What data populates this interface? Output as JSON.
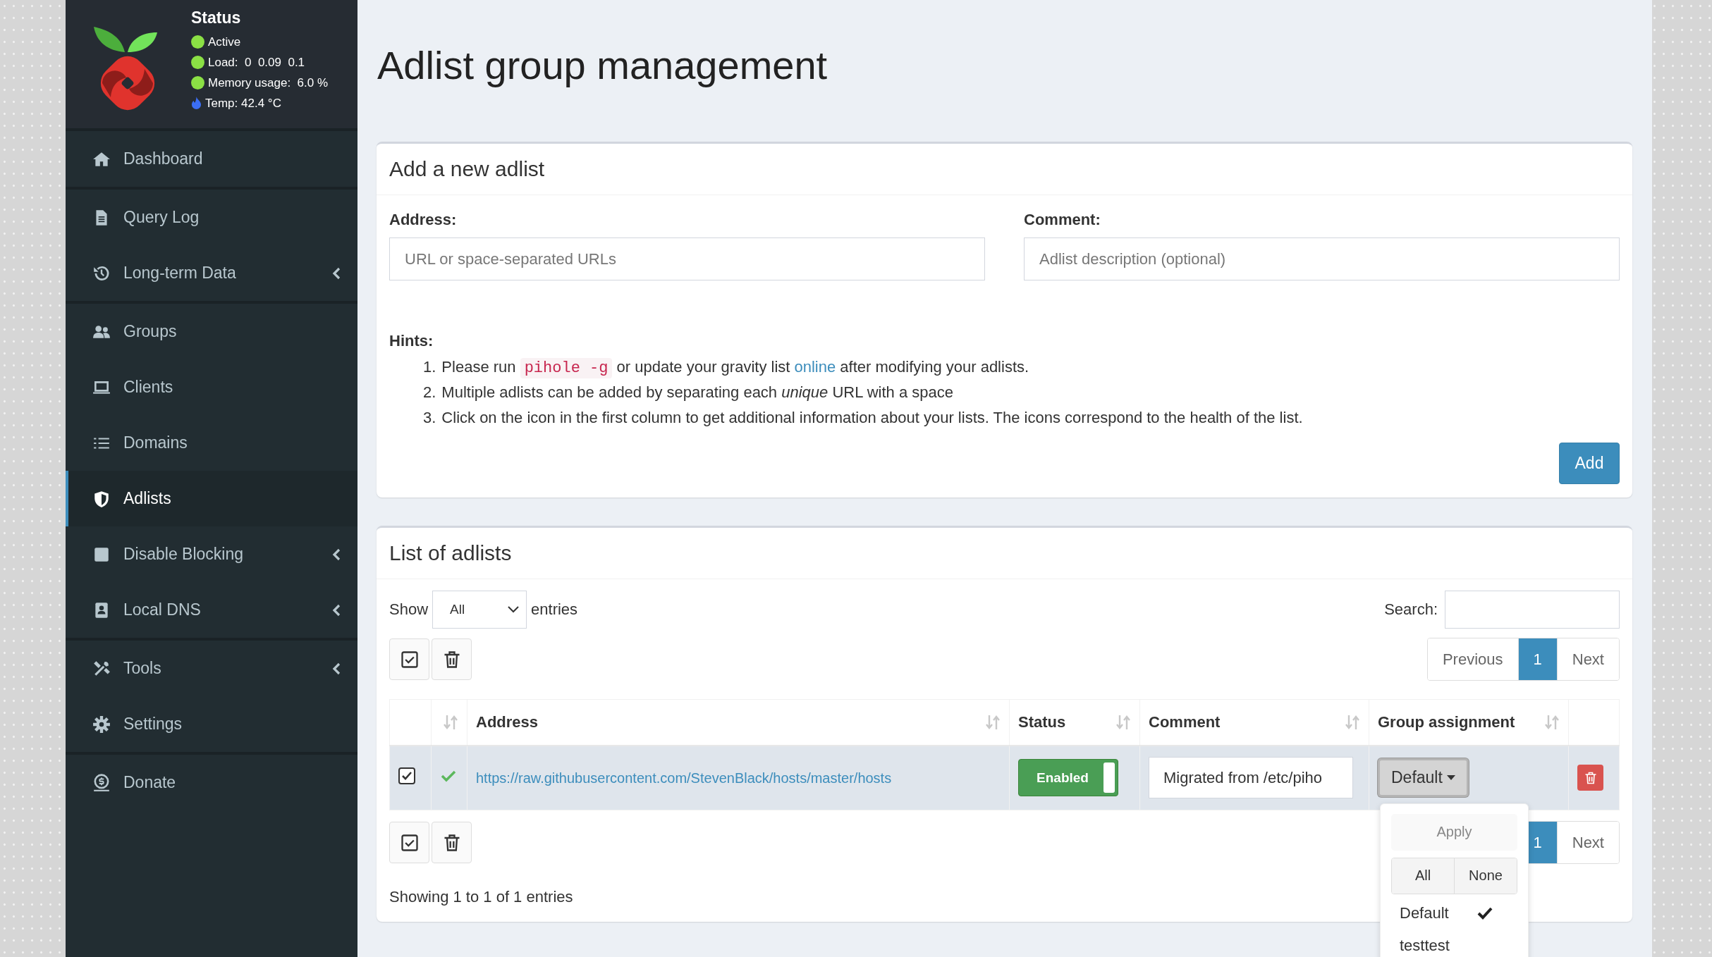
{
  "sidebar": {
    "status": {
      "title": "Status",
      "items": [
        {
          "kind": "dot",
          "text": "Active"
        },
        {
          "kind": "dot",
          "text": "Load:  0  0.09  0.1"
        },
        {
          "kind": "dot",
          "text": "Memory usage:  6.0 %"
        },
        {
          "kind": "temperature",
          "text": "Temp: 42.4 °C"
        }
      ]
    },
    "sections": [
      {
        "items": [
          {
            "label": "Dashboard",
            "selected": false,
            "submenu": false
          }
        ]
      },
      {
        "items": [
          {
            "label": "Query Log",
            "selected": false,
            "submenu": false
          },
          {
            "label": "Long-term Data",
            "selected": false,
            "submenu": true
          }
        ]
      },
      {
        "items": [
          {
            "label": "Groups",
            "selected": false,
            "submenu": false
          },
          {
            "label": "Clients",
            "selected": false,
            "submenu": false
          },
          {
            "label": "Domains",
            "selected": false,
            "submenu": false
          },
          {
            "label": "Adlists",
            "selected": true,
            "submenu": false
          },
          {
            "label": "Disable Blocking",
            "selected": false,
            "submenu": true
          },
          {
            "label": "Local DNS",
            "selected": false,
            "submenu": true
          }
        ]
      },
      {
        "items": [
          {
            "label": "Tools",
            "selected": false,
            "submenu": true
          },
          {
            "label": "Settings",
            "selected": false,
            "submenu": false
          }
        ]
      },
      {
        "items": [
          {
            "label": "Donate",
            "selected": false,
            "submenu": false
          }
        ]
      }
    ]
  },
  "page_title": "Adlist group management",
  "add_card": {
    "title": "Add a new adlist",
    "fields": [
      {
        "label": "Address:",
        "placeholder": "URL or space-separated URLs"
      },
      {
        "label": "Comment:",
        "placeholder": "Adlist description (optional)"
      }
    ],
    "hints": {
      "title": "Hints:",
      "items": [
        {
          "number": "1.",
          "parts": [
            {
              "kind": "text",
              "text": "Please run "
            },
            {
              "kind": "code",
              "text": "pihole -g"
            },
            {
              "kind": "text",
              "text": " or update your gravity list "
            },
            {
              "kind": "link",
              "text": "online"
            },
            {
              "kind": "text",
              "text": " after modifying your adlists."
            }
          ]
        },
        {
          "number": "2.",
          "parts": [
            {
              "kind": "text",
              "text": "Multiple adlists can be added by separating each "
            },
            {
              "kind": "emphasis",
              "text": "unique"
            },
            {
              "kind": "text",
              "text": " URL with a space"
            }
          ]
        },
        {
          "number": "3.",
          "parts": [
            {
              "kind": "text",
              "text": "Click on the icon in the first column to get additional information about your lists. The icons correspond to the health of the list."
            }
          ]
        }
      ]
    },
    "button": "Add"
  },
  "list_card": {
    "title": "List of adlists",
    "length": {
      "label": "Show",
      "value": "All",
      "suffix": "entries"
    },
    "search": {
      "label": "Search:"
    },
    "pagination_top": [
      {
        "label": "Previous",
        "selected": false
      },
      {
        "label": "1",
        "selected": true
      },
      {
        "label": "Next",
        "selected": false
      }
    ],
    "table": {
      "columns": [
        {
          "kind": "select"
        },
        {
          "kind": "sortable"
        },
        {
          "kind": "sortable",
          "label": "Address"
        },
        {
          "kind": "sortable",
          "label": "Status"
        },
        {
          "kind": "sortable",
          "label": "Comment"
        },
        {
          "kind": "sortable",
          "label": "Group assignment"
        },
        {
          "kind": "plain"
        }
      ],
      "rows": [
        {
          "selected": true,
          "address": "https://raw.githubusercontent.com/StevenBlack/hosts/master/hosts",
          "enabled": true,
          "status": "Enabled",
          "comment": "Migrated from /etc/piho",
          "group": "Default"
        }
      ]
    },
    "group_menu": {
      "apply": {
        "label": "Apply",
        "disabled": true
      },
      "all": "All",
      "none": "None",
      "options": [
        {
          "label": "Default",
          "checked": true
        },
        {
          "label": "testtest",
          "checked": false
        }
      ]
    },
    "pagination_bottom": [
      {
        "label": "1",
        "selected": true
      },
      {
        "label": "Next",
        "selected": false
      }
    ],
    "info": "Showing 1 to 1 of 1 entries"
  }
}
